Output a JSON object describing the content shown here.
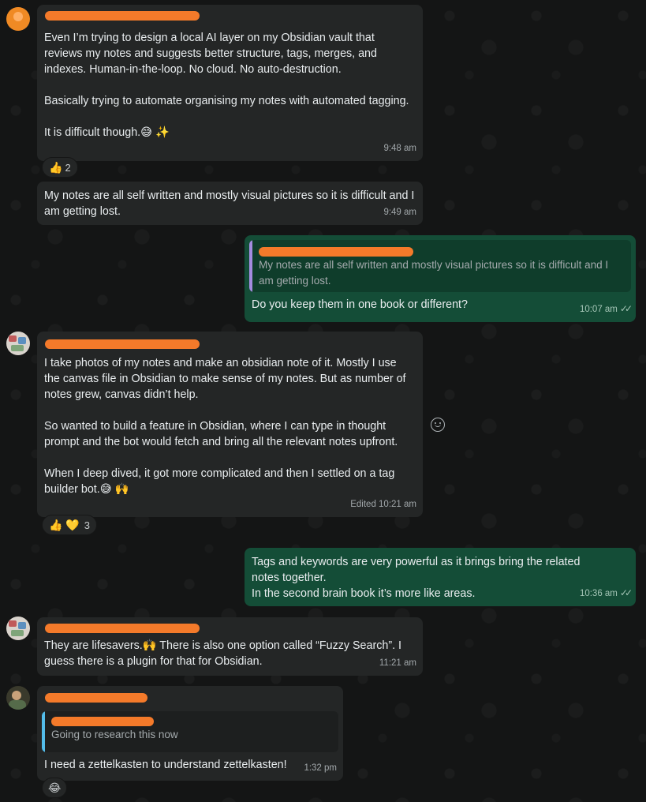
{
  "messages": [
    {
      "text": "Even I’m trying to design a local AI layer on my Obsidian vault that reviews my notes and suggests better structure, tags, merges, and indexes. Human-in-the-loop. No cloud. No auto-destruction.\n\nBasically trying to automate organising my notes with automated tagging.\n\nIt is difficult though.😅 ✨",
      "time": "9:48 am",
      "reaction_emoji": "👍",
      "reaction_count": "2"
    },
    {
      "text": "My notes are all self written and mostly visual pictures so it is difficult and I am getting lost.",
      "time": "9:49 am"
    },
    {
      "quote": "My notes are all self written and mostly visual pictures so it is difficult and I am getting lost.",
      "text": "Do you keep them in one book or different?",
      "time": "10:07 am",
      "ticks": "✓✓"
    },
    {
      "text": "I take photos of my notes and make an obsidian note of it. Mostly I use the canvas file in Obsidian to make sense of my notes. But as number of notes grew, canvas didn’t help.\n\nSo wanted to build a feature in Obsidian, where I can type in thought prompt and the bot would fetch and bring all the relevant notes upfront.\n\nWhen I deep dived, it got more complicated and then I settled on a tag builder bot.😅 🙌",
      "time": "Edited 10:21 am",
      "reaction_emoji": "👍 💛",
      "reaction_count": "3"
    },
    {
      "text": "Tags and keywords are very powerful as it brings bring the related notes together.\nIn the second brain book it’s more like areas.",
      "time": "10:36 am",
      "ticks": "✓✓"
    },
    {
      "text": "They are lifesavers.🙌 There is also one option called “Fuzzy Search”. I guess there is a plugin for that for Obsidian.",
      "time": "11:21 am"
    },
    {
      "quote": "Going to research this now",
      "text": "I need a zettelkasten to understand zettelkasten!",
      "time": "1:32 pm",
      "reaction_emoji": "😂"
    }
  ],
  "colors": {
    "incoming_bubble": "#242626",
    "outgoing_bubble": "#144d37",
    "redaction": "#f47a2a",
    "background": "#161717"
  }
}
